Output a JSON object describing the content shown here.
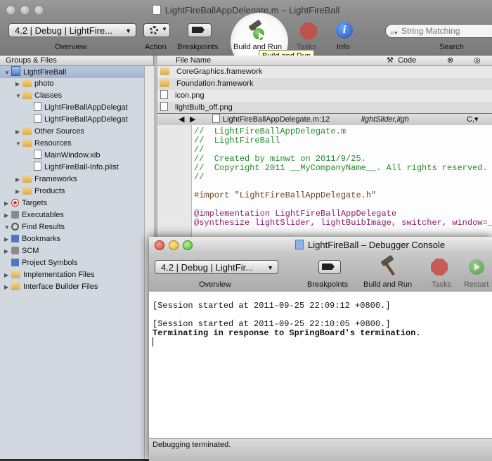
{
  "main_window": {
    "title": "LightFireBallAppDelegate.m – LightFireBall",
    "toolbar": {
      "overview_popup": "4.2 | Debug | LightFire...",
      "overview_label": "Overview",
      "action_label": "Action",
      "breakpoints_label": "Breakpoints",
      "build_and_run_label": "Build and Run",
      "tasks_label": "Tasks",
      "info_label": "Info",
      "search_placeholder": "String Matching",
      "search_label": "Search",
      "tooltip": "Build and Run"
    },
    "sidebar": {
      "header": "Groups & Files",
      "items": [
        {
          "label": "LightFireBall",
          "depth": 0,
          "icon": "project-icon",
          "disclosure": "open",
          "selected": true
        },
        {
          "label": "photo",
          "depth": 1,
          "icon": "folder-icon",
          "disclosure": "closed"
        },
        {
          "label": "Classes",
          "depth": 1,
          "icon": "folder-icon",
          "disclosure": "open"
        },
        {
          "label": "LightFireBallAppDelegat",
          "depth": 2,
          "icon": "header-file-icon",
          "disclosure": ""
        },
        {
          "label": "LightFireBallAppDelegat",
          "depth": 2,
          "icon": "source-file-icon",
          "disclosure": ""
        },
        {
          "label": "Other Sources",
          "depth": 1,
          "icon": "folder-icon",
          "disclosure": "closed"
        },
        {
          "label": "Resources",
          "depth": 1,
          "icon": "folder-icon",
          "disclosure": "open"
        },
        {
          "label": "MainWindow.xib",
          "depth": 2,
          "icon": "file-icon",
          "disclosure": ""
        },
        {
          "label": "LightFireBall-Info.plist",
          "depth": 2,
          "icon": "file-icon",
          "disclosure": ""
        },
        {
          "label": "Frameworks",
          "depth": 1,
          "icon": "folder-icon",
          "disclosure": "closed"
        },
        {
          "label": "Products",
          "depth": 1,
          "icon": "folder-icon",
          "disclosure": "closed"
        },
        {
          "label": "Targets",
          "depth": 0,
          "icon": "target-icon",
          "disclosure": "closed"
        },
        {
          "label": "Executables",
          "depth": 0,
          "icon": "executable-icon",
          "disclosure": "closed"
        },
        {
          "label": "Find Results",
          "depth": 0,
          "icon": "search-icon",
          "disclosure": "open"
        },
        {
          "label": "Bookmarks",
          "depth": 0,
          "icon": "bookmark-icon",
          "disclosure": "closed"
        },
        {
          "label": "SCM",
          "depth": 0,
          "icon": "scm-icon",
          "disclosure": "closed"
        },
        {
          "label": "Project Symbols",
          "depth": 0,
          "icon": "symbols-icon",
          "disclosure": ""
        },
        {
          "label": "Implementation Files",
          "depth": 0,
          "icon": "folder-icon",
          "disclosure": "closed"
        },
        {
          "label": "Interface Builder Files",
          "depth": 0,
          "icon": "folder-icon",
          "disclosure": "closed"
        }
      ]
    },
    "file_list": {
      "columns": {
        "name": "File Name",
        "code": "Code"
      },
      "rows": [
        "CoreGraphics.framework",
        "Foundation.framework",
        "icon.png",
        "lightBulb_off.png"
      ]
    },
    "editor": {
      "file_popup": "LightFireBallAppDelegate.m:12",
      "symbol_popup": "lightSlider,ligh",
      "lines": [
        {
          "text": "//  LightFireBallAppDelegate.m",
          "kind": "comment"
        },
        {
          "text": "//  LightFireBall",
          "kind": "comment"
        },
        {
          "text": "//",
          "kind": "comment"
        },
        {
          "text": "//  Created by minwt on 2011/9/25.",
          "kind": "comment"
        },
        {
          "text": "//  Copyright 2011 __MyCompanyName__. All rights reserved.",
          "kind": "comment"
        },
        {
          "text": "//",
          "kind": "comment"
        },
        {
          "text": "",
          "kind": "plain"
        },
        {
          "text": "#import \"LightFireBallAppDelegate.h\"",
          "kind": "pre"
        },
        {
          "text": "",
          "kind": "plain"
        },
        {
          "text": "@implementation LightFireBallAppDelegate",
          "kind": "dir"
        },
        {
          "text": "@synthesize lightSlider, lightBuibImage, switcher, window=_wi",
          "kind": "dir"
        }
      ]
    }
  },
  "console_window": {
    "title": "LightFireBall – Debugger Console",
    "toolbar": {
      "overview_popup": "4.2 | Debug | LightFir...",
      "overview_label": "Overview",
      "breakpoints_label": "Breakpoints",
      "build_and_run_label": "Build and Run",
      "tasks_label": "Tasks",
      "restart_label": "Restart"
    },
    "lines": [
      {
        "text": "[Session started at 2011-09-25 22:09:12 +0800.]",
        "bold": false
      },
      {
        "text": "",
        "bold": false
      },
      {
        "text": "[Session started at 2011-09-25 22:10:05 +0800.]",
        "bold": false
      },
      {
        "text": "Terminating in response to SpringBoard's termination.",
        "bold": true
      }
    ],
    "status": "Debugging terminated."
  },
  "colors": {
    "comment": "#238a2b",
    "directive": "#8a1f73",
    "selection": "#a3b5cf",
    "tooltip_bg": "#ffffc8",
    "close_red": "#e0443e",
    "minimize_yellow": "#e6b428",
    "zoom_green": "#5cb83a"
  }
}
